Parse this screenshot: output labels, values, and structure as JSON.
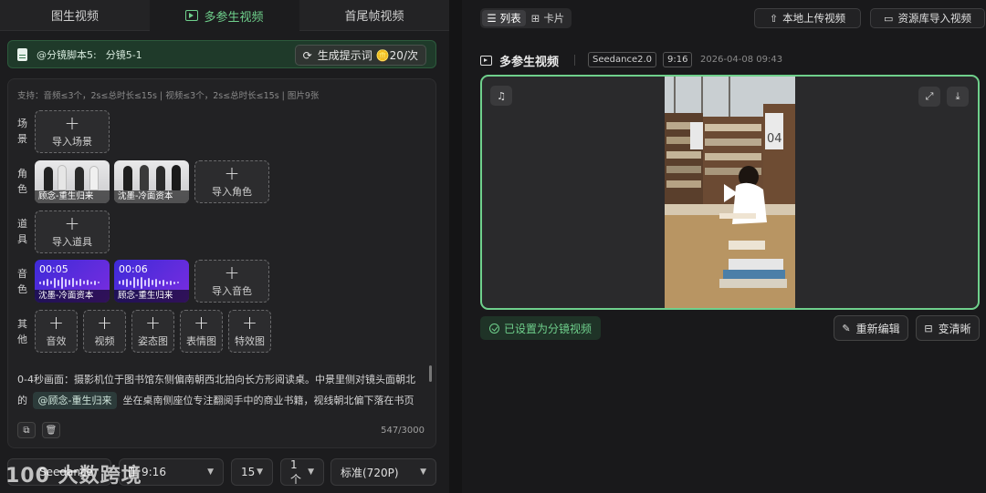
{
  "tabs": [
    {
      "label": "图生视频",
      "active": false
    },
    {
      "label": "多参生视频",
      "active": true
    },
    {
      "label": "首尾帧视频",
      "active": false
    }
  ],
  "script_bar": {
    "script": "@分镜脚本5:",
    "shot": "分镜5-1",
    "generate_label": "生成提示词",
    "generate_cost": "20/次"
  },
  "support_text": "支持：音频≤3个，2s≤总时长≤15s | 视频≤3个，2s≤总时长≤15s | 图片9张",
  "rows": {
    "scene": {
      "label": "场景",
      "add": "导入场景"
    },
    "character": {
      "label": "角色",
      "chips": [
        "顾念-重生归来",
        "沈墨-冷面资本"
      ],
      "add": "导入角色"
    },
    "prop": {
      "label": "道具",
      "add": "导入道具"
    },
    "audio": {
      "label": "音色",
      "chips": [
        {
          "time": "00:05",
          "name": "沈墨-冷面资本"
        },
        {
          "time": "00:06",
          "name": "顾念-重生归来"
        }
      ],
      "add": "导入音色"
    },
    "other": {
      "label": "其他",
      "items": [
        "音效",
        "视频",
        "姿态图",
        "表情图",
        "特效图"
      ]
    }
  },
  "prompt": {
    "line1": "0-4秒画面：摄影机位于图书馆东侧偏南朝西北拍向长方形阅读桌。中景里侧对镜头面朝北",
    "line2_pre": "的",
    "mention": "@顾念-重生归来",
    "line2_post": "坐在桌南侧座位专注翻阅手中的商业书籍，视线朝北偏下落在书页",
    "char_count": "547/3000"
  },
  "bottom": {
    "model": "Seedance",
    "ratio": "9:16",
    "duration": "15",
    "count": "1个",
    "quality": "标准(720P)"
  },
  "watermark": "100 大数跨境",
  "right": {
    "view_list": "列表",
    "view_card": "卡片",
    "upload_local": "本地上传视频",
    "import_library": "资源库导入视频",
    "title": "多参生视频",
    "model_tag": "Seedance2.0",
    "ratio_tag": "9:16",
    "timestamp": "2026-04-08 09:43",
    "set_shot": "已设置为分镜视频",
    "reedit": "重新编辑",
    "sharpen": "变清晰",
    "shelf_label": "04"
  },
  "colors": {
    "accent": "#6fd08c",
    "voice_chip": "#5a2ad8"
  }
}
